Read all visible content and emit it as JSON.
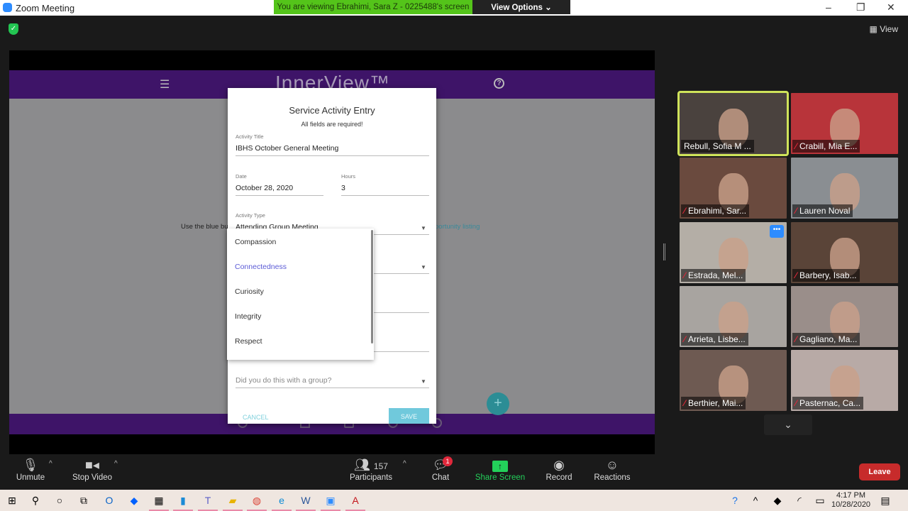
{
  "window": {
    "title": "Zoom Meeting",
    "banner": "You are viewing Ebrahimi, Sara Z - 0225488's screen",
    "view_options": "View Options ⌄",
    "view": "View"
  },
  "app": {
    "logo": "InnerView™",
    "body_text": "Use the blue but",
    "body_link": "portunity listing"
  },
  "dialog": {
    "title": "Service Activity Entry",
    "subtitle": "All fields are required!",
    "activity_title_label": "Activity Title",
    "activity_title": "IBHS October General Meeting",
    "date_label": "Date",
    "date": "October 28, 2020",
    "hours_label": "Hours",
    "hours": "3",
    "activity_type_label": "Activity Type",
    "activity_type": "Attending Group Meeting",
    "group_placeholder": "Did you do this with a group?",
    "cancel": "CANCEL",
    "save": "SAVE"
  },
  "dropdown": {
    "options": [
      "Compassion",
      "Connectedness",
      "Curiosity",
      "Integrity",
      "Respect"
    ],
    "highlighted": "Connectedness",
    "highlight_color": "#5b5bd6"
  },
  "participants": [
    {
      "name": "Rebull, Sofia M ...",
      "muted": false
    },
    {
      "name": "Crabill, Mia E...",
      "muted": true
    },
    {
      "name": "Ebrahimi, Sar...",
      "muted": true
    },
    {
      "name": "Lauren Noval",
      "muted": true
    },
    {
      "name": "Estrada, Mel...",
      "muted": true
    },
    {
      "name": "Barbery, Isab...",
      "muted": true
    },
    {
      "name": "Arrieta, Lisbe...",
      "muted": true
    },
    {
      "name": "Gagliano, Ma...",
      "muted": true
    },
    {
      "name": "Berthier, Mai...",
      "muted": true
    },
    {
      "name": "Pasternac, Ca...",
      "muted": true
    }
  ],
  "toolbar": {
    "unmute": "Unmute",
    "stop_video": "Stop Video",
    "participants": "Participants",
    "participant_count": "157",
    "chat": "Chat",
    "chat_badge": "1",
    "share_screen": "Share Screen",
    "record": "Record",
    "reactions": "Reactions",
    "leave": "Leave"
  },
  "taskbar": {
    "time": "4:17 PM",
    "date": "10/28/2020"
  }
}
